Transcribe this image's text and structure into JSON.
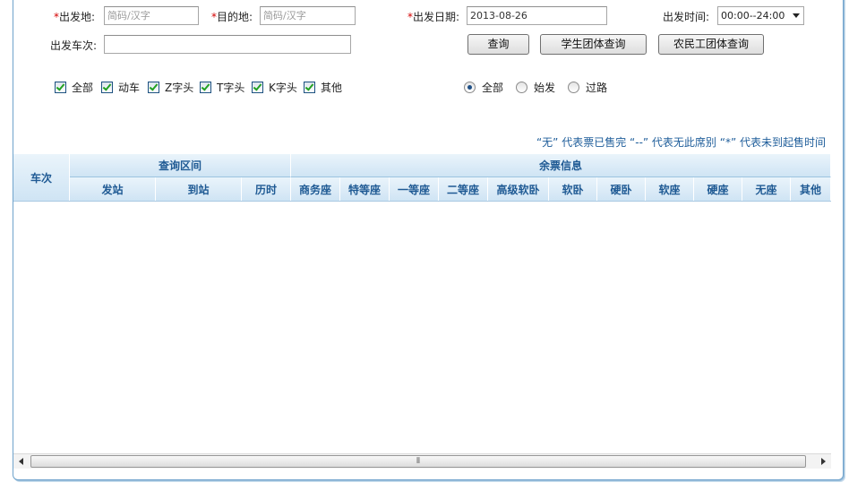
{
  "form": {
    "from_label": "出发地:",
    "from_placeholder": "简码/汉字",
    "to_label": "目的地:",
    "to_placeholder": "简码/汉字",
    "date_label": "出发日期:",
    "date_value": "2013-08-26",
    "time_label": "出发时间:",
    "time_value": "00:00--24:00",
    "train_no_label": "出发车次:",
    "train_no_value": "",
    "required_mark": "*"
  },
  "buttons": {
    "query": "查询",
    "student_query": "学生团体查询",
    "migrant_query": "农民工团体查询"
  },
  "train_types": [
    {
      "label": "全部",
      "checked": true
    },
    {
      "label": "动车",
      "checked": true
    },
    {
      "label": "Z字头",
      "checked": true
    },
    {
      "label": "T字头",
      "checked": true
    },
    {
      "label": "K字头",
      "checked": true
    },
    {
      "label": "其他",
      "checked": true
    }
  ],
  "station_filter": [
    {
      "label": "全部",
      "selected": true
    },
    {
      "label": "始发",
      "selected": false
    },
    {
      "label": "过路",
      "selected": false
    }
  ],
  "legend": "“无” 代表票已售完  “--” 代表无此席别  “*” 代表未到起售时间",
  "table": {
    "train_header": "车次",
    "interval_header": "查询区间",
    "interval_columns": [
      "发站",
      "到站",
      "历时"
    ],
    "ticket_header": "余票信息",
    "ticket_columns": [
      "商务座",
      "特等座",
      "一等座",
      "二等座",
      "高级软卧",
      "软卧",
      "硬卧",
      "软座",
      "硬座",
      "无座",
      "其他"
    ],
    "rows": []
  },
  "colors": {
    "header_text": "#1f5a94",
    "required": "#d40000",
    "frame_border": "#6fa3cc"
  }
}
